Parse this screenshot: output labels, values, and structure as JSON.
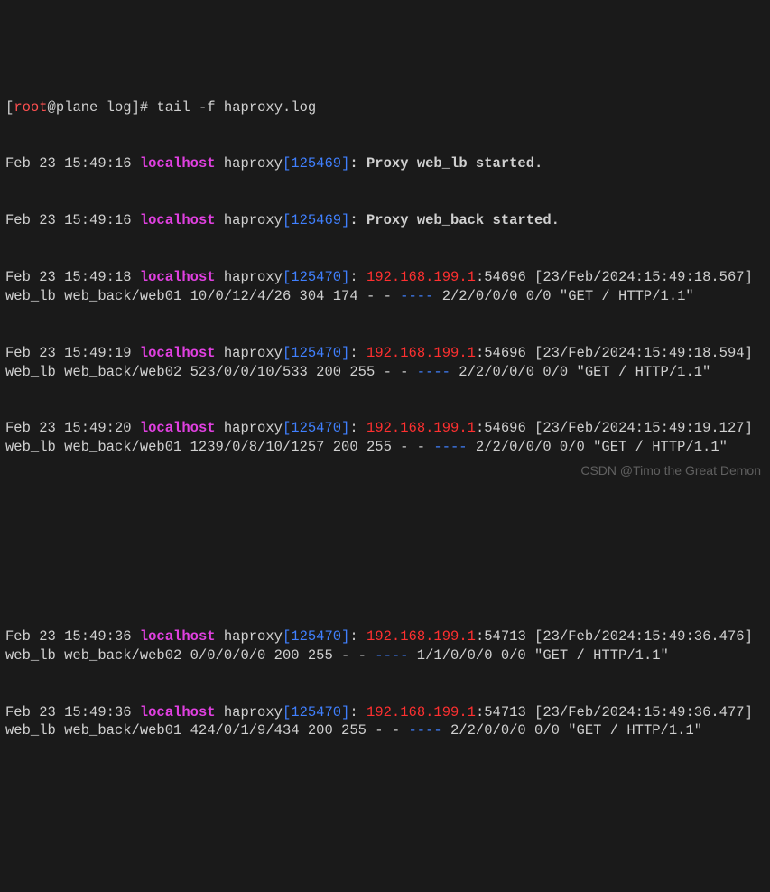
{
  "prompt": {
    "user": "root",
    "at": "@",
    "host": "plane",
    "path": " log",
    "open_bracket": "[",
    "close_bracket": "]",
    "hash": "# ",
    "command": "tail -f haproxy.log"
  },
  "lines": {
    "l1_pre": "Feb 23 15:49:16 ",
    "l1_host": "localhost",
    "l1_proc": " haproxy",
    "l1_pidopen": "[",
    "l1_pid": "125469",
    "l1_pidclose": "]",
    "l1_rest": ": Proxy web_lb started.",
    "l2_pre": "Feb 23 15:49:16 ",
    "l2_host": "localhost",
    "l2_proc": " haproxy",
    "l2_pidopen": "[",
    "l2_pid": "125469",
    "l2_pidclose": "]",
    "l2_rest": ": Proxy web_back started.",
    "l3_pre": "Feb 23 15:49:18 ",
    "l3_host": "localhost",
    "l3_proc": " haproxy",
    "l3_pidopen": "[",
    "l3_pid": "125470",
    "l3_pidclose": "]",
    "l3_colon": ": ",
    "l3_ip": "192.168.199.1",
    "l3_port": ":54696 [23/Feb/2024:15:49:18.567] web_lb web_back/web01 10/0/12/4/26 304 174 - - ",
    "l3_dashes": "----",
    "l3_tail": " 2/2/0/0/0 0/0 \"GET / HTTP/1.1\"",
    "l4_pre": "Feb 23 15:49:19 ",
    "l4_host": "localhost",
    "l4_proc": " haproxy",
    "l4_pidopen": "[",
    "l4_pid": "125470",
    "l4_pidclose": "]",
    "l4_colon": ": ",
    "l4_ip": "192.168.199.1",
    "l4_port": ":54696 [23/Feb/2024:15:49:18.594] web_lb web_back/web02 523/0/0/10/533 200 255 - - ",
    "l4_dashes": "----",
    "l4_tail": " 2/2/0/0/0 0/0 \"GET / HTTP/1.1\"",
    "l5_pre": "Feb 23 15:49:20 ",
    "l5_host": "localhost",
    "l5_proc": " haproxy",
    "l5_pidopen": "[",
    "l5_pid": "125470",
    "l5_pidclose": "]",
    "l5_colon": ": ",
    "l5_ip": "192.168.199.1",
    "l5_port": ":54696 [23/Feb/2024:15:49:19.127] web_lb web_back/web01 1239/0/8/10/1257 200 255 - - ",
    "l5_dashes": "----",
    "l5_tail": " 2/2/0/0/0 0/0 \"GET / HTTP/1.1\"",
    "l6_pre": "Feb 23 15:49:36 ",
    "l6_host": "localhost",
    "l6_proc": " haproxy",
    "l6_pidopen": "[",
    "l6_pid": "125470",
    "l6_pidclose": "]",
    "l6_colon": ": ",
    "l6_ip": "192.168.199.1",
    "l6_port": ":54713 [23/Feb/2024:15:49:36.476] web_lb web_back/web02 0/0/0/0/0 200 255 - - ",
    "l6_dashes": "----",
    "l6_tail": " 1/1/0/0/0 0/0 \"GET / HTTP/1.1\"",
    "l7_pre": "Feb 23 15:49:36 ",
    "l7_host": "localhost",
    "l7_proc": " haproxy",
    "l7_pidopen": "[",
    "l7_pid": "125470",
    "l7_pidclose": "]",
    "l7_colon": ": ",
    "l7_ip": "192.168.199.1",
    "l7_port": ":54713 [23/Feb/2024:15:49:36.477] web_lb web_back/web01 424/0/1/9/434 200 255 - - ",
    "l7_dashes": "----",
    "l7_tail": " 2/2/0/0/0 0/0 \"GET / HTTP/1.1\""
  },
  "watermark": "CSDN @Timo the Great Demon"
}
